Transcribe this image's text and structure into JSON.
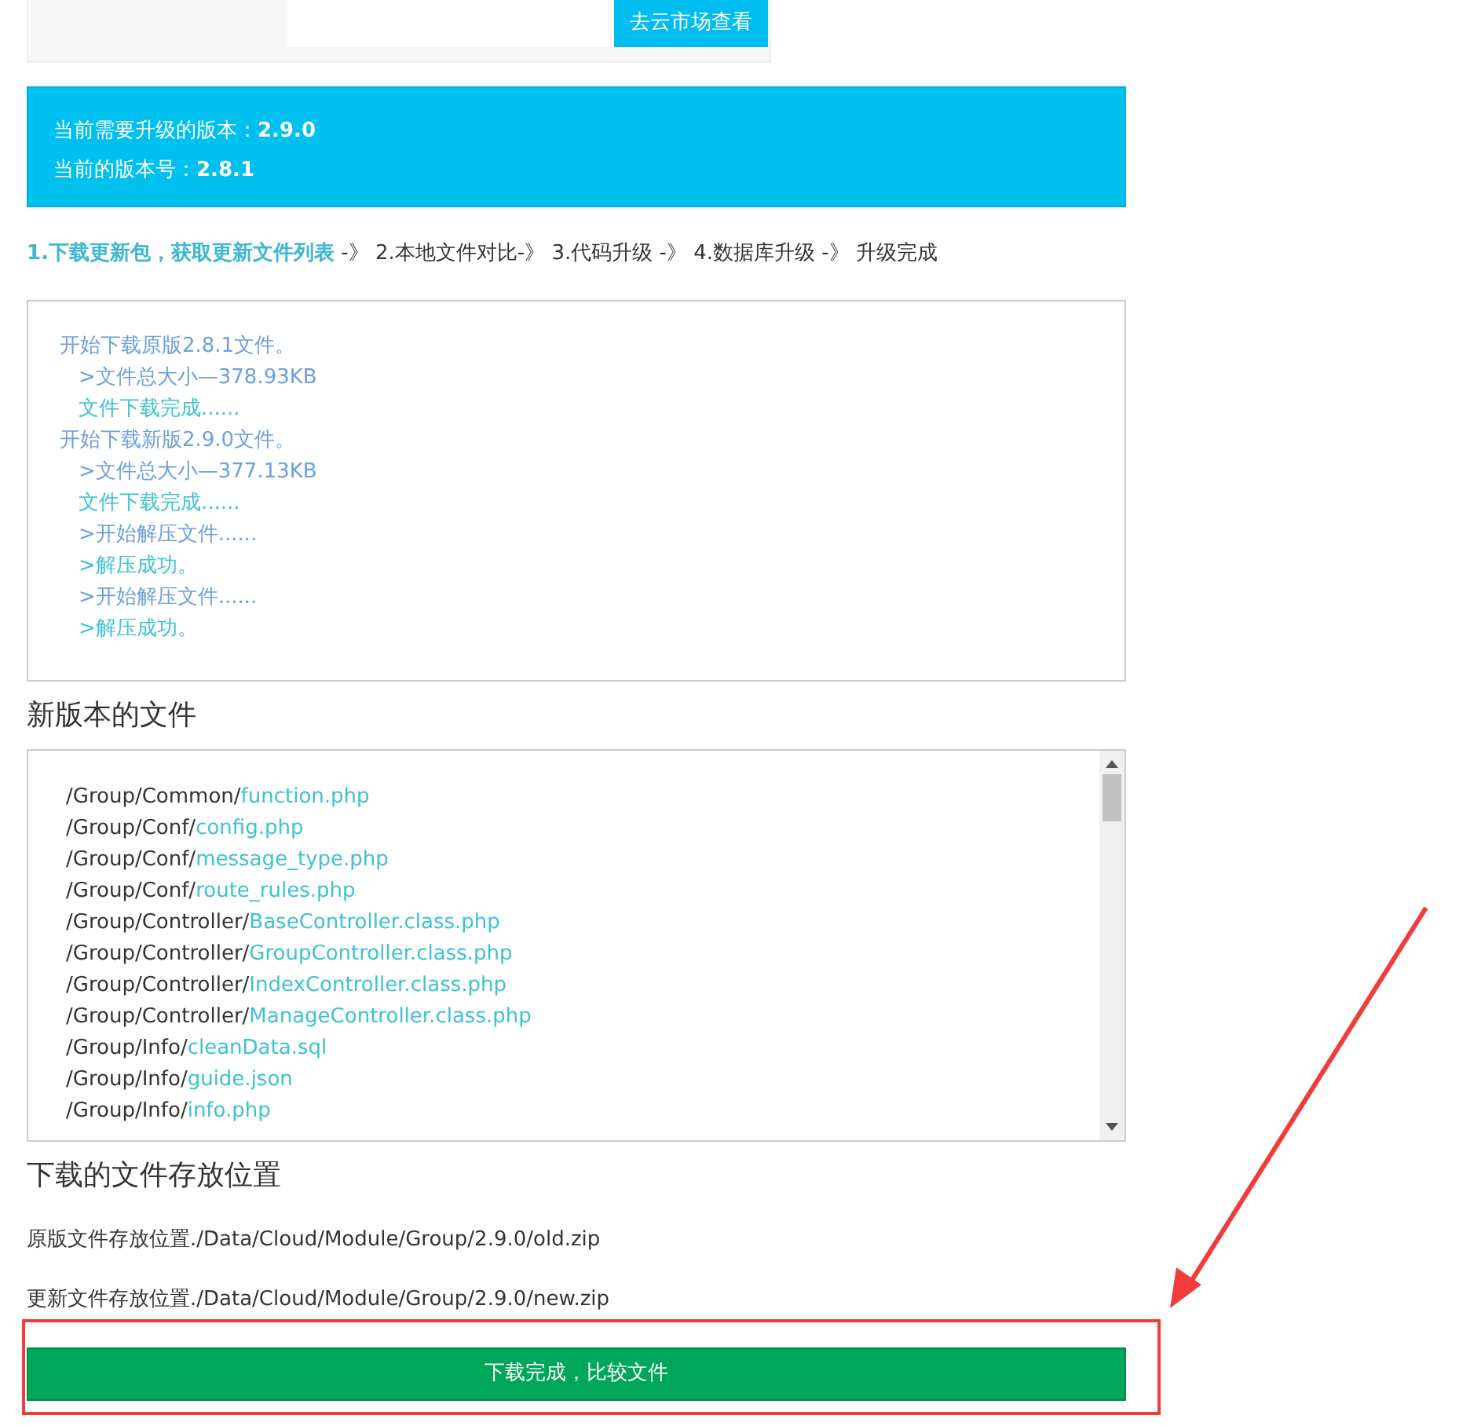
{
  "market_button": "去云市场查看",
  "version_info": [
    {
      "label": "当前需要升级的版本：",
      "value": "2.9.0"
    },
    {
      "label": "当前的版本号：",
      "value": "2.8.1"
    }
  ],
  "steps": [
    {
      "label": "1.下载更新包，获取更新文件列表",
      "arrow": " -》",
      "selected": true
    },
    {
      "label": "2.本地文件对比",
      "arrow": "-》",
      "selected": false
    },
    {
      "label": "3.代码升级",
      "arrow": " -》",
      "selected": false
    },
    {
      "label": "4.数据库升级",
      "arrow": " -》",
      "selected": false
    },
    {
      "label": "升级完成",
      "selected": false
    }
  ],
  "log": [
    {
      "kind": "start",
      "text": "开始下载原版2.8.1文件。"
    },
    {
      "kind": "size",
      "text": ">文件总大小—378.93KB"
    },
    {
      "kind": "done",
      "text": "文件下载完成......"
    },
    {
      "kind": "start",
      "text": "开始下载新版2.9.0文件。"
    },
    {
      "kind": "size",
      "text": ">文件总大小—377.13KB"
    },
    {
      "kind": "done",
      "text": "文件下载完成......"
    },
    {
      "kind": "size",
      "text": ">开始解压文件......"
    },
    {
      "kind": "done",
      "text": ">解压成功。"
    },
    {
      "kind": "size",
      "text": ">开始解压文件......"
    },
    {
      "kind": "done",
      "text": ">解压成功。"
    }
  ],
  "new_files_title": "新版本的文件",
  "new_files": [
    {
      "dir": "/Group/Common/",
      "file": "function.php"
    },
    {
      "dir": "/Group/Conf/",
      "file": "config.php"
    },
    {
      "dir": "/Group/Conf/",
      "file": "message_type.php"
    },
    {
      "dir": "/Group/Conf/",
      "file": "route_rules.php"
    },
    {
      "dir": "/Group/Controller/",
      "file": "BaseController.class.php"
    },
    {
      "dir": "/Group/Controller/",
      "file": "GroupController.class.php"
    },
    {
      "dir": "/Group/Controller/",
      "file": "IndexController.class.php"
    },
    {
      "dir": "/Group/Controller/",
      "file": "ManageController.class.php"
    },
    {
      "dir": "/Group/Info/",
      "file": "cleanData.sql"
    },
    {
      "dir": "/Group/Info/",
      "file": "guide.json"
    },
    {
      "dir": "/Group/Info/",
      "file": "info.php"
    }
  ],
  "location_title": "下载的文件存放位置",
  "locations": [
    "原版文件存放位置./Data/Cloud/Module/Group/2.9.0/old.zip",
    "更新文件存放位置./Data/Cloud/Module/Group/2.9.0/new.zip"
  ],
  "compare_button": "下载完成，比较文件"
}
